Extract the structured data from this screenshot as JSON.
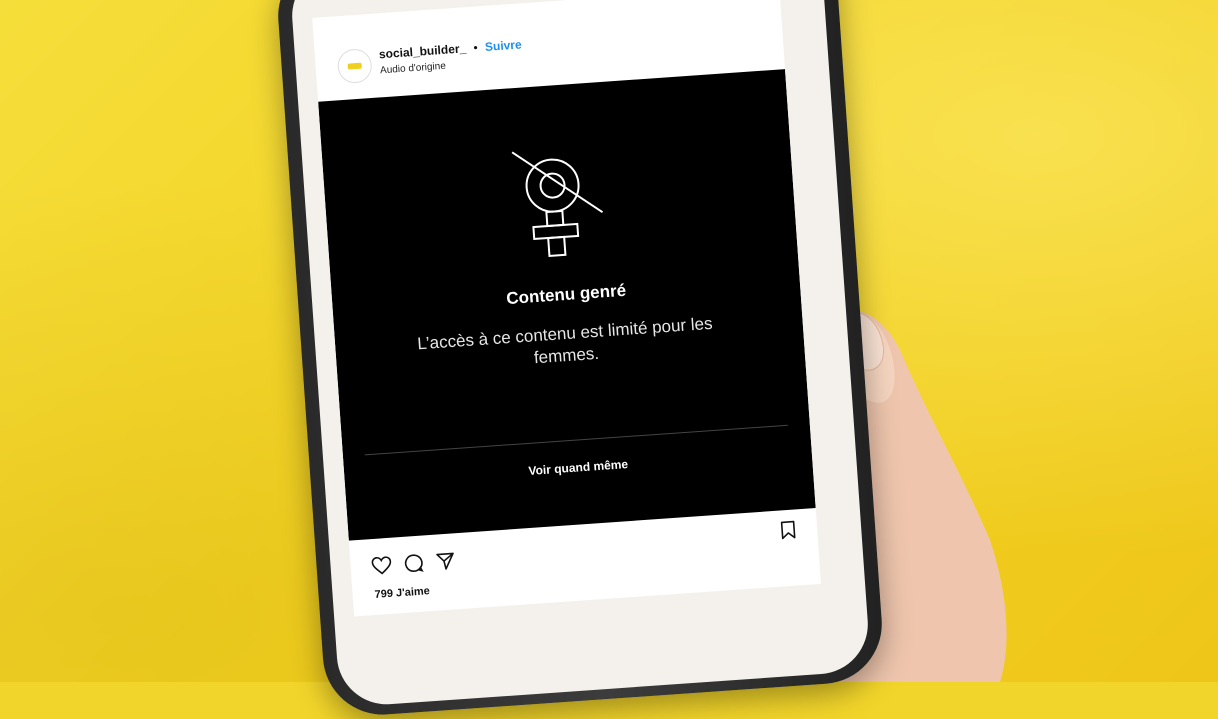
{
  "post": {
    "username": "social_builder_",
    "separator": "•",
    "follow_label": "Suivre",
    "audio_label": "Audio d'origine"
  },
  "media": {
    "title": "Contenu genré",
    "subtitle": "L’accès à ce contenu est limité pour les femmes.",
    "view_anyway_label": "Voir quand même",
    "symbol_icon": "female-symbol-crossed-icon"
  },
  "actions": {
    "like_icon": "heart-icon",
    "comment_icon": "comment-icon",
    "share_icon": "send-icon",
    "save_icon": "bookmark-icon"
  },
  "likes_label": "799 J'aime",
  "colors": {
    "background": "#f2d52a",
    "accent": "#1d8ff0",
    "media_bg": "#000000"
  }
}
